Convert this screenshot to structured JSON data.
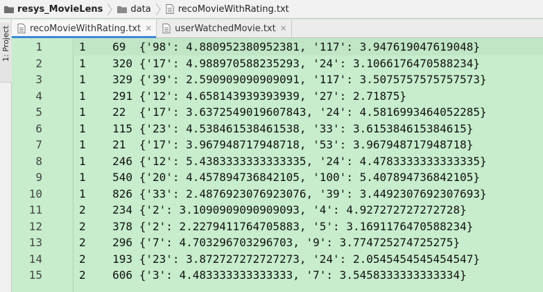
{
  "breadcrumb": {
    "project": "resys_MovieLens",
    "folder": "data",
    "file": "recoMovieWithRating.txt"
  },
  "tool_window": {
    "label": "1: Project"
  },
  "tabs": [
    {
      "label": "recoMovieWithRating.txt",
      "active": true
    },
    {
      "label": "userWatchedMovie.txt",
      "active": false
    }
  ],
  "editor": {
    "lines": [
      {
        "num": "1",
        "text": "1    69  {'98': 4.880952380952381, '117': 3.947619047619048}"
      },
      {
        "num": "2",
        "text": "1    320 {'17': 4.988970588235293, '24': 3.1066176470588234}"
      },
      {
        "num": "3",
        "text": "1    329 {'39': 2.590909090909091, '117': 3.5075757575757573}"
      },
      {
        "num": "4",
        "text": "1    291 {'12': 4.658143939393939, '27': 2.71875}"
      },
      {
        "num": "5",
        "text": "1    22  {'17': 3.6372549019607843, '24': 4.5816993464052285}"
      },
      {
        "num": "6",
        "text": "1    115 {'23': 4.538461538461538, '33': 3.615384615384615}"
      },
      {
        "num": "7",
        "text": "1    21  {'17': 3.967948717948718, '53': 3.967948717948718}"
      },
      {
        "num": "8",
        "text": "1    246 {'12': 5.4383333333333335, '24': 4.4783333333333335}"
      },
      {
        "num": "9",
        "text": "1    540 {'20': 4.457894736842105, '100': 5.407894736842105}"
      },
      {
        "num": "10",
        "text": "1    826 {'33': 2.4876923076923076, '39': 3.4492307692307693}"
      },
      {
        "num": "11",
        "text": "2    234 {'2': 3.1090909090909093, '4': 4.927272727272728}"
      },
      {
        "num": "12",
        "text": "2    378 {'2': 2.2279411764705883, '5': 3.1691176470588234}"
      },
      {
        "num": "13",
        "text": "2    296 {'7': 4.703296703296703, '9': 3.774725274725275}"
      },
      {
        "num": "14",
        "text": "2    193 {'23': 3.872727272727273, '24': 2.0545454545454547}"
      },
      {
        "num": "15",
        "text": "2    606 {'3': 4.483333333333333, '7': 3.5458333333333334}"
      }
    ]
  },
  "colors": {
    "editor_background": "#c7edcc",
    "active_tab_underline": "#3a86d9"
  }
}
